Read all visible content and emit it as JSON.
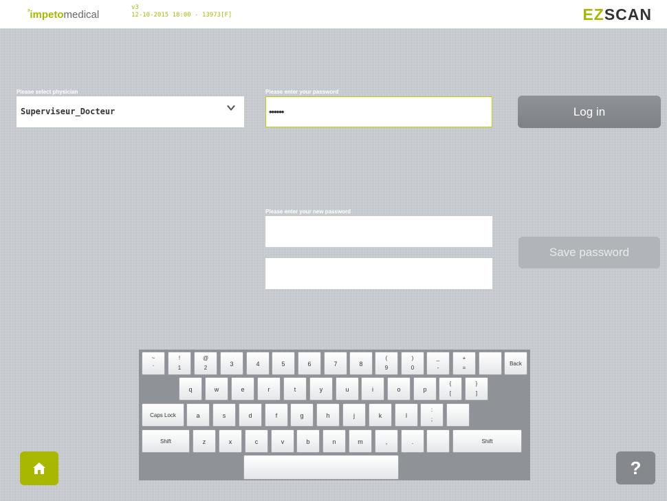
{
  "header": {
    "brand_prefix": "³",
    "brand_part1": "impeto",
    "brand_part2": "medical",
    "version": "v3",
    "build_info": "12-10-2015 18:00 - 13973[F]",
    "product_part1": "EZ",
    "product_part2": "SCAN"
  },
  "login": {
    "physician_label": "Please select physician",
    "physician_value": "Superviseur_Docteur",
    "password_label": "Please enter your password",
    "password_value": "••••••",
    "login_button": "Log in"
  },
  "new_password": {
    "label": "Please enter your new password",
    "value": "",
    "confirm_value": "",
    "save_button": "Save password"
  },
  "keyboard": {
    "row1": [
      {
        "top": "~",
        "bottom": "`"
      },
      {
        "top": "!",
        "bottom": "1"
      },
      {
        "top": "@",
        "bottom": "2"
      },
      {
        "main": "3"
      },
      {
        "main": "4"
      },
      {
        "main": "5"
      },
      {
        "main": "6"
      },
      {
        "main": "7"
      },
      {
        "main": "8"
      },
      {
        "top": "(",
        "bottom": "9"
      },
      {
        "top": ")",
        "bottom": "0"
      },
      {
        "top": "_",
        "bottom": "-"
      },
      {
        "top": "+",
        "bottom": "="
      },
      {
        "main": ""
      }
    ],
    "row2": [
      {
        "main": "q"
      },
      {
        "main": "w"
      },
      {
        "main": "e"
      },
      {
        "main": "r"
      },
      {
        "main": "t"
      },
      {
        "main": "y"
      },
      {
        "main": "u"
      },
      {
        "main": "i"
      },
      {
        "main": "o"
      },
      {
        "main": "p"
      },
      {
        "top": "{",
        "bottom": "["
      },
      {
        "top": "}",
        "bottom": "]"
      }
    ],
    "row3": [
      {
        "main": "a"
      },
      {
        "main": "s"
      },
      {
        "main": "d"
      },
      {
        "main": "f"
      },
      {
        "main": "g"
      },
      {
        "main": "h"
      },
      {
        "main": "j"
      },
      {
        "main": "k"
      },
      {
        "main": "l"
      },
      {
        "top": ":",
        "bottom": ";"
      },
      {
        "main": ""
      }
    ],
    "row4": [
      {
        "main": "z"
      },
      {
        "main": "x"
      },
      {
        "main": "c"
      },
      {
        "main": "v"
      },
      {
        "main": "b"
      },
      {
        "main": "n"
      },
      {
        "main": "m"
      },
      {
        "main": ","
      },
      {
        "main": "."
      },
      {
        "main": ""
      }
    ],
    "back": "Back",
    "caps_lock": "Caps Lock",
    "shift": "Shift",
    "space": ""
  },
  "footer": {
    "home_icon": "home-icon",
    "help_label": "?"
  },
  "colors": {
    "accent": "#a8b800",
    "background": "#c4c8cd",
    "button": "#85898e"
  }
}
